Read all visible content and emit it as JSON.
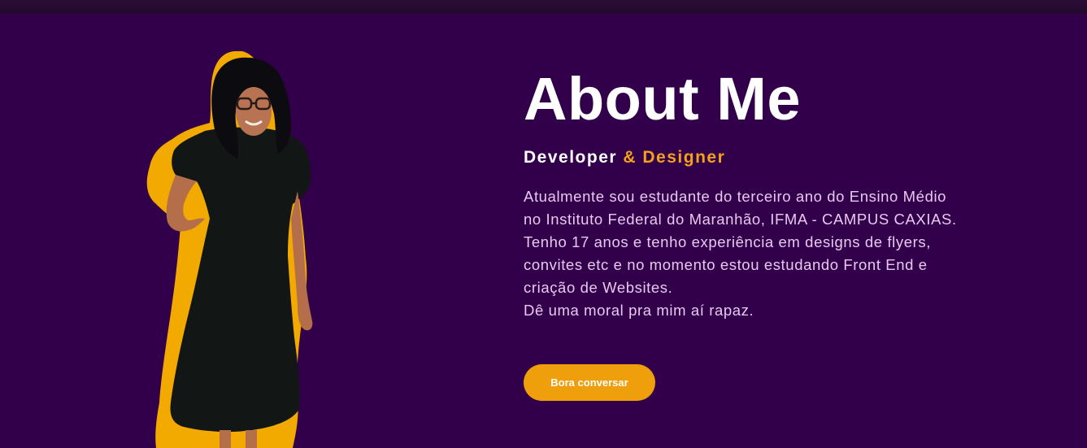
{
  "about": {
    "title": "About Me",
    "subtitle_primary": "Developer",
    "subtitle_accent": "& Designer",
    "bio_lines": [
      "Atualmente sou estudante do terceiro ano do Ensino Médio",
      "no Instituto Federal do Maranhão, IFMA - CAMPUS CAXIAS.",
      "Tenho 17 anos e tenho experiência em designs de flyers,",
      "convites etc e no momento estou estudando Front End e",
      "criação de Websites.",
      "Dê uma moral pra mim aí rapaz."
    ],
    "cta_label": "Bora conversar"
  },
  "colors": {
    "background": "#32004a",
    "accent": "#f4a21e",
    "button": "#ef9f0c",
    "bio_text": "#e9c8f0",
    "title_text": "#ffffff"
  }
}
